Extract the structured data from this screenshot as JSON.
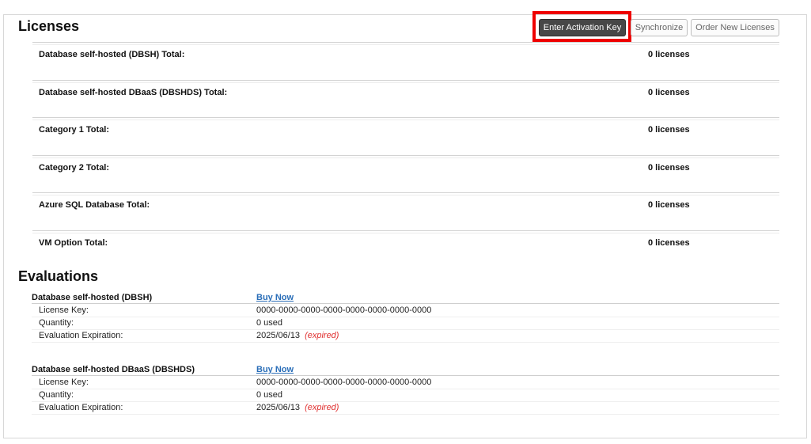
{
  "licenses": {
    "heading": "Licenses",
    "buttons": {
      "enter_activation_key": "Enter Activation Key",
      "synchronize": "Synchronize",
      "order_new_licenses": "Order New Licenses"
    },
    "rows": [
      {
        "label": "Database self-hosted (DBSH) Total:",
        "value": "0 licenses"
      },
      {
        "label": "Database self-hosted DBaaS (DBSHDS) Total:",
        "value": "0 licenses"
      },
      {
        "label": "Category 1 Total:",
        "value": "0 licenses"
      },
      {
        "label": "Category 2 Total:",
        "value": "0 licenses"
      },
      {
        "label": "Azure SQL Database Total:",
        "value": "0 licenses"
      },
      {
        "label": "VM Option Total:",
        "value": "0 licenses"
      }
    ]
  },
  "evaluations": {
    "heading": "Evaluations",
    "items": [
      {
        "title": "Database self-hosted (DBSH)",
        "buy_now": "Buy Now",
        "fields": {
          "license_key_label": "License Key:",
          "license_key_value": "0000-0000-0000-0000-0000-0000-0000-0000",
          "quantity_label": "Quantity:",
          "quantity_value": "0 used",
          "expiration_label": "Evaluation Expiration:",
          "expiration_date": "2025/06/13",
          "expiration_status": "(expired)"
        }
      },
      {
        "title": "Database self-hosted DBaaS (DBSHDS)",
        "buy_now": "Buy Now",
        "fields": {
          "license_key_label": "License Key:",
          "license_key_value": "0000-0000-0000-0000-0000-0000-0000-0000",
          "quantity_label": "Quantity:",
          "quantity_value": "0 used",
          "expiration_label": "Evaluation Expiration:",
          "expiration_date": "2025/06/13",
          "expiration_status": "(expired)"
        }
      }
    ]
  },
  "colors": {
    "highlight": "#ee0000",
    "link": "#2a6eb8",
    "expired": "#e03030",
    "primary_button": "#474747"
  }
}
